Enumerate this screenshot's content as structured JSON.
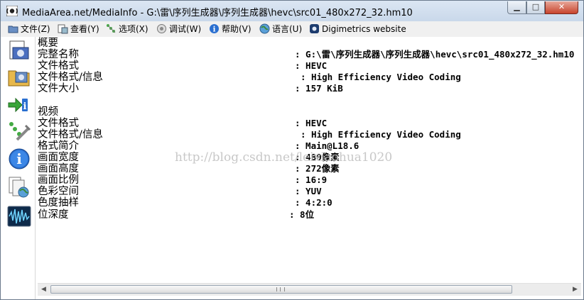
{
  "window": {
    "title": "MediaArea.net/MediaInfo - G:\\雷\\序列生成器\\序列生成器\\hevc\\src01_480x272_32.hm10",
    "minimize_glyph": "▁",
    "maximize_glyph": "□",
    "close_glyph": "✕"
  },
  "menu": [
    {
      "label": "文件(Z)",
      "icon": "folder-icon"
    },
    {
      "label": "查看(Y)",
      "icon": "view-icon"
    },
    {
      "label": "选项(X)",
      "icon": "options-icon"
    },
    {
      "label": "调试(W)",
      "icon": "debug-icon"
    },
    {
      "label": "帮助(V)",
      "icon": "help-icon"
    },
    {
      "label": "语言(U)",
      "icon": "globe-icon"
    },
    {
      "label": "Digimetrics website",
      "icon": "digimetrics-icon"
    }
  ],
  "sidebar": [
    {
      "name": "open-file-icon"
    },
    {
      "name": "open-folder-icon"
    },
    {
      "name": "export-info-icon"
    },
    {
      "name": "preferences-icon"
    },
    {
      "name": "about-icon"
    },
    {
      "name": "web-icon"
    },
    {
      "name": "waveform-icon"
    }
  ],
  "rows": [
    {
      "label": "概要",
      "value": "",
      "indent": 0
    },
    {
      "label": "完整名称",
      "value": ": G:\\雷\\序列生成器\\序列生成器\\hevc\\src01_480x272_32.hm10",
      "indent": 0
    },
    {
      "label": "文件格式",
      "value": ": HEVC",
      "indent": 0
    },
    {
      "label": "文件格式/信息",
      "value": ": High Efficiency Video Coding",
      "indent": 1
    },
    {
      "label": "文件大小",
      "value": ": 157 KiB",
      "indent": 0
    },
    {
      "label": "",
      "value": "",
      "indent": 0
    },
    {
      "label": "视频",
      "value": "",
      "indent": 0
    },
    {
      "label": "文件格式",
      "value": ": HEVC",
      "indent": 0
    },
    {
      "label": "文件格式/信息",
      "value": ": High Efficiency Video Coding",
      "indent": 1
    },
    {
      "label": "格式简介",
      "value": ": Main@L18.6",
      "indent": 0
    },
    {
      "label": "画面宽度",
      "value": ": 480像素",
      "indent": 0
    },
    {
      "label": "画面高度",
      "value": ": 272像素",
      "indent": 0
    },
    {
      "label": "画面比例",
      "value": ": 16:9",
      "indent": 0
    },
    {
      "label": "色彩空间",
      "value": ": YUV",
      "indent": 0
    },
    {
      "label": "色度抽样",
      "value": ": 4:2:0",
      "indent": 0
    },
    {
      "label": "位深度",
      "value": ": 8位",
      "indent": -1
    }
  ],
  "watermark": "http://blog.csdn.net/leixiaohua1020",
  "scrollbar": {
    "left": "◀",
    "right": "▶"
  }
}
